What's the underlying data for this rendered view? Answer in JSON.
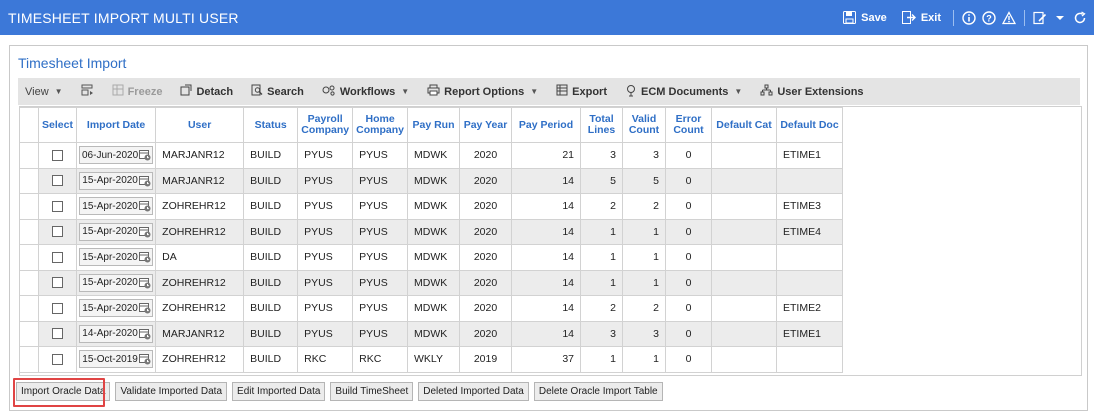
{
  "header": {
    "title": "TIMESHEET IMPORT MULTI USER",
    "save_label": "Save",
    "exit_label": "Exit"
  },
  "panel": {
    "title": "Timesheet Import"
  },
  "toolbar": {
    "view": "View",
    "freeze": "Freeze",
    "detach": "Detach",
    "search": "Search",
    "workflows": "Workflows",
    "report_options": "Report Options",
    "export": "Export",
    "ecm_documents": "ECM Documents",
    "user_extensions": "User Extensions"
  },
  "table": {
    "columns": [
      "Select",
      "Import Date",
      "User",
      "Status",
      "Payroll Company",
      "Home Company",
      "Pay Run",
      "Pay Year",
      "Pay Period",
      "Total Lines",
      "Valid Count",
      "Error Count",
      "Default Cat",
      "Default Doc"
    ],
    "rows": [
      {
        "date": "06-Jun-2020",
        "user": "MARJANR12",
        "status": "BUILD",
        "payroll": "PYUS",
        "home": "PYUS",
        "payrun": "MDWK",
        "year": "2020",
        "period": "21",
        "total": "3",
        "valid": "3",
        "error": "0",
        "cat": "",
        "doc": "ETIME1"
      },
      {
        "date": "15-Apr-2020",
        "user": "MARJANR12",
        "status": "BUILD",
        "payroll": "PYUS",
        "home": "PYUS",
        "payrun": "MDWK",
        "year": "2020",
        "period": "14",
        "total": "5",
        "valid": "5",
        "error": "0",
        "cat": "",
        "doc": ""
      },
      {
        "date": "15-Apr-2020",
        "user": "ZOHREHR12",
        "status": "BUILD",
        "payroll": "PYUS",
        "home": "PYUS",
        "payrun": "MDWK",
        "year": "2020",
        "period": "14",
        "total": "2",
        "valid": "2",
        "error": "0",
        "cat": "",
        "doc": "ETIME3"
      },
      {
        "date": "15-Apr-2020",
        "user": "ZOHREHR12",
        "status": "BUILD",
        "payroll": "PYUS",
        "home": "PYUS",
        "payrun": "MDWK",
        "year": "2020",
        "period": "14",
        "total": "1",
        "valid": "1",
        "error": "0",
        "cat": "",
        "doc": "ETIME4"
      },
      {
        "date": "15-Apr-2020",
        "user": "DA",
        "status": "BUILD",
        "payroll": "PYUS",
        "home": "PYUS",
        "payrun": "MDWK",
        "year": "2020",
        "period": "14",
        "total": "1",
        "valid": "1",
        "error": "0",
        "cat": "",
        "doc": ""
      },
      {
        "date": "15-Apr-2020",
        "user": "ZOHREHR12",
        "status": "BUILD",
        "payroll": "PYUS",
        "home": "PYUS",
        "payrun": "MDWK",
        "year": "2020",
        "period": "14",
        "total": "1",
        "valid": "1",
        "error": "0",
        "cat": "",
        "doc": ""
      },
      {
        "date": "15-Apr-2020",
        "user": "ZOHREHR12",
        "status": "BUILD",
        "payroll": "PYUS",
        "home": "PYUS",
        "payrun": "MDWK",
        "year": "2020",
        "period": "14",
        "total": "2",
        "valid": "2",
        "error": "0",
        "cat": "",
        "doc": "ETIME2"
      },
      {
        "date": "14-Apr-2020",
        "user": "MARJANR12",
        "status": "BUILD",
        "payroll": "PYUS",
        "home": "PYUS",
        "payrun": "MDWK",
        "year": "2020",
        "period": "14",
        "total": "3",
        "valid": "3",
        "error": "0",
        "cat": "",
        "doc": "ETIME1"
      },
      {
        "date": "15-Oct-2019",
        "user": "ZOHREHR12",
        "status": "BUILD",
        "payroll": "RKC",
        "home": "RKC",
        "payrun": "WKLY",
        "year": "2019",
        "period": "37",
        "total": "1",
        "valid": "1",
        "error": "0",
        "cat": "",
        "doc": ""
      }
    ]
  },
  "footer": {
    "import_oracle": "Import Oracle Data",
    "validate": "Validate Imported Data",
    "edit": "Edit Imported Data",
    "build": "Build TimeSheet",
    "deleted": "Deleted Imported Data",
    "delete_table": "Delete Oracle Import Table"
  },
  "colors": {
    "header_bg": "#3c78d8",
    "link_blue": "#2f6fc6",
    "highlight": "#e04444"
  }
}
